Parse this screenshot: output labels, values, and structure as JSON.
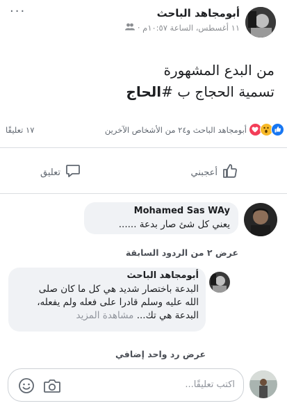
{
  "post": {
    "author": "أبومجاهد الباحث",
    "meta": "١١ أغسطس، الساعة ١٠:٥٧م ·",
    "more": "···",
    "line1": "من البدع المشهورة",
    "line2_prefix": "تسمية الحجاج ب #",
    "hashtag": "الحاج",
    "reactions_text": "أبومجاهد الباحث و٢٤ من الأشخاص الآخرين",
    "comments_count": "١٧ تعليقًا",
    "reaction_icons": [
      "like-icon",
      "wow-icon",
      "love-icon"
    ],
    "colors": {
      "like": "#1877f2",
      "wow": "#f7b928",
      "love": "#f33e58"
    }
  },
  "actions": {
    "like": "أعجبني",
    "comment": "تعليق"
  },
  "comments": [
    {
      "name": "Mohamed Sas WAy",
      "text": "يعني كل شئ صار بدعة ......"
    }
  ],
  "view_previous": "عرض ٢ من الردود السابقة",
  "reply": {
    "name": "أبومجاهد الباحث",
    "line1": "البدعة باختصار شديد هي كل ما كان صلى",
    "line2": "الله عليه وسلم قادرا على فعله ولم يفعله،",
    "line3": "البدعة هي تك...",
    "see_more": "مشاهدة المزيد"
  },
  "view_more_reply": "عرض رد واحد إضافي",
  "composer": {
    "placeholder": "اكتب تعليقًا..."
  }
}
